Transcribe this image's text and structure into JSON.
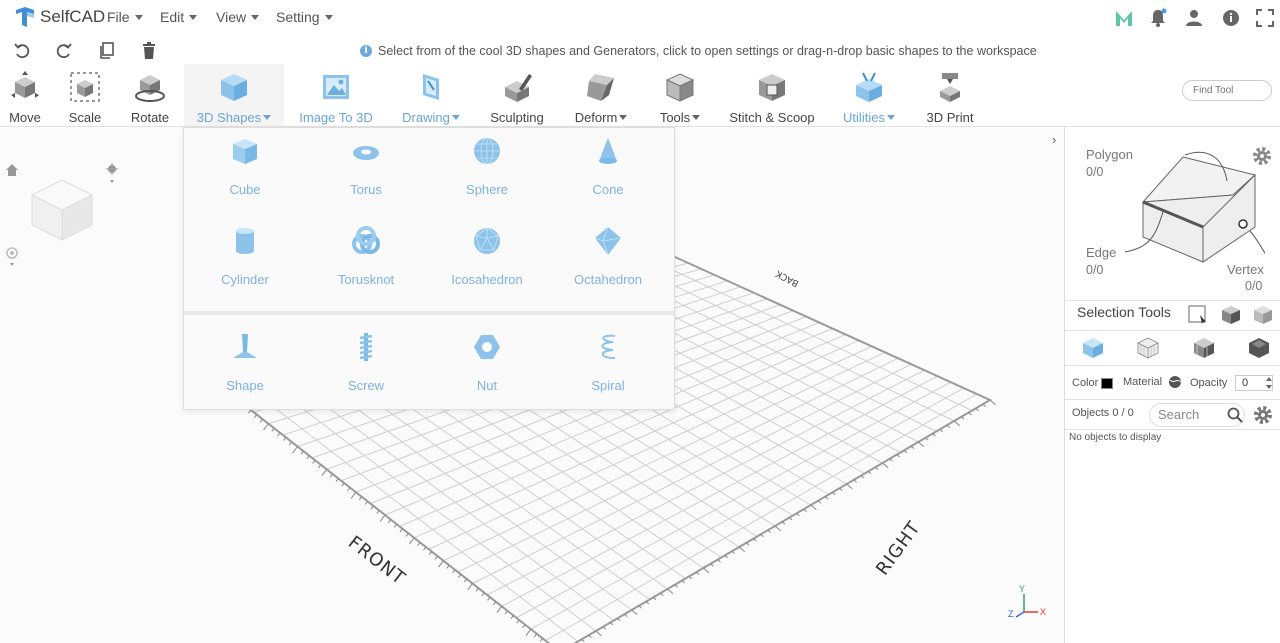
{
  "app": {
    "name": "SelfCAD"
  },
  "menus": [
    {
      "label": "File"
    },
    {
      "label": "Edit"
    },
    {
      "label": "View"
    },
    {
      "label": "Setting"
    }
  ],
  "hint": "Select from of the cool 3D shapes and Generators, click to open settings or drag-n-drop basic shapes to the workspace",
  "toolbar": {
    "items": [
      {
        "label": "Move",
        "icon": "move-icon"
      },
      {
        "label": "Scale",
        "icon": "scale-icon"
      },
      {
        "label": "Rotate",
        "icon": "rotate-icon"
      },
      {
        "label": "3D Shapes",
        "icon": "cube-icon"
      },
      {
        "label": "Image To 3D",
        "icon": "image-icon"
      },
      {
        "label": "Drawing",
        "icon": "drawing-icon"
      },
      {
        "label": "Sculpting",
        "icon": "sculpting-icon"
      },
      {
        "label": "Deform",
        "icon": "deform-icon"
      },
      {
        "label": "Tools",
        "icon": "tools-icon"
      },
      {
        "label": "Stitch & Scoop",
        "icon": "stitch-icon"
      },
      {
        "label": "Utilities",
        "icon": "utilities-icon"
      },
      {
        "label": "3D Print",
        "icon": "print-icon"
      }
    ],
    "find_placeholder": "Find Tool"
  },
  "shapes": {
    "basic": [
      {
        "label": "Cube"
      },
      {
        "label": "Torus"
      },
      {
        "label": "Sphere"
      },
      {
        "label": "Cone"
      },
      {
        "label": "Cylinder"
      },
      {
        "label": "Torusknot"
      },
      {
        "label": "Icosahedron"
      },
      {
        "label": "Octahedron"
      }
    ],
    "generators": [
      {
        "label": "Shape"
      },
      {
        "label": "Screw"
      },
      {
        "label": "Nut"
      },
      {
        "label": "Spiral"
      }
    ]
  },
  "viewport": {
    "labels": {
      "front": "FRONT",
      "right": "RIGHT",
      "back": "BACK"
    },
    "axes": {
      "x": "X",
      "y": "Y",
      "z": "Z"
    }
  },
  "panel": {
    "polygon": {
      "label": "Polygon",
      "count": "0/0"
    },
    "edge": {
      "label": "Edge",
      "count": "0/0"
    },
    "vertex": {
      "label": "Vertex",
      "count": "0/0"
    },
    "selection_tools": "Selection Tools",
    "color_label": "Color",
    "material_label": "Material",
    "opacity_label": "Opacity",
    "opacity_value": "0",
    "objects_label": "Objects 0 / 0",
    "search_placeholder": "Search",
    "empty_text": "No objects to display"
  },
  "colors": {
    "accent": "#6aa5d8",
    "shape": "#8dc3ea"
  }
}
